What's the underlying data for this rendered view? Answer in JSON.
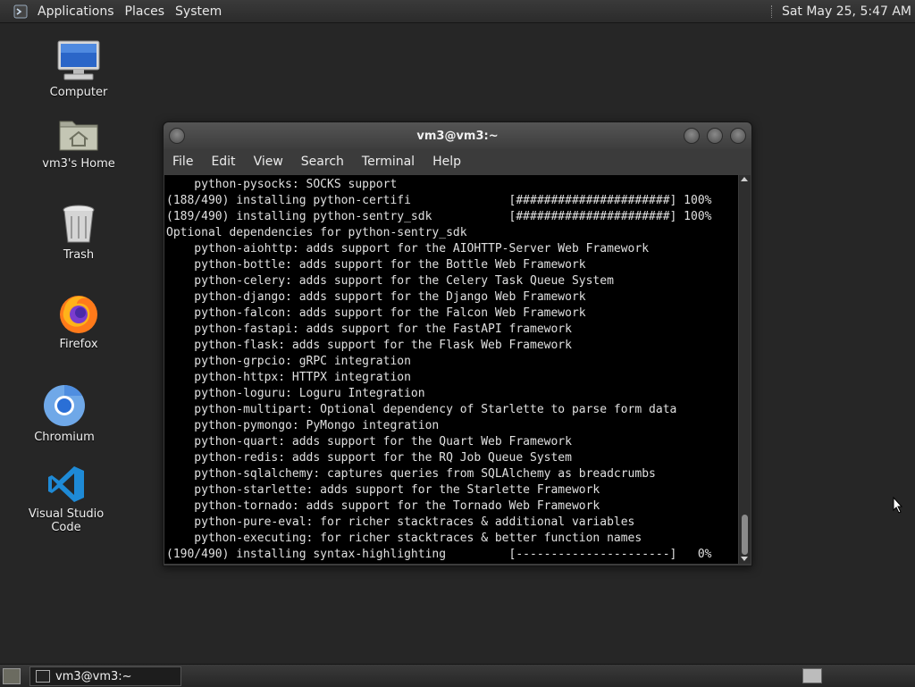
{
  "top_panel": {
    "applications": "Applications",
    "places": "Places",
    "system": "System",
    "clock": "Sat May 25,  5:47 AM"
  },
  "desktop": {
    "icons": [
      {
        "label": "Computer",
        "icon": "computer-icon"
      },
      {
        "label": "vm3's Home",
        "icon": "home-folder-icon"
      },
      {
        "label": "Trash",
        "icon": "trash-icon"
      },
      {
        "label": "Firefox",
        "icon": "firefox-icon"
      },
      {
        "label": "Chromium",
        "icon": "chromium-icon"
      },
      {
        "label": "Visual Studio Code",
        "icon": "vscode-icon"
      }
    ]
  },
  "window": {
    "title": "vm3@vm3:~",
    "menu": [
      "File",
      "Edit",
      "View",
      "Search",
      "Terminal",
      "Help"
    ]
  },
  "terminal": {
    "lines": [
      "    python-pysocks: SOCKS support",
      "(188/490) installing python-certifi              [######################] 100%",
      "(189/490) installing python-sentry_sdk           [######################] 100%",
      "Optional dependencies for python-sentry_sdk",
      "    python-aiohttp: adds support for the AIOHTTP-Server Web Framework",
      "    python-bottle: adds support for the Bottle Web Framework",
      "    python-celery: adds support for the Celery Task Queue System",
      "    python-django: adds support for the Django Web Framework",
      "    python-falcon: adds support for the Falcon Web Framework",
      "    python-fastapi: adds support for the FastAPI framework",
      "    python-flask: adds support for the Flask Web Framework",
      "    python-grpcio: gRPC integration",
      "    python-httpx: HTTPX integration",
      "    python-loguru: Loguru Integration",
      "    python-multipart: Optional dependency of Starlette to parse form data",
      "    python-pymongo: PyMongo integration",
      "    python-quart: adds support for the Quart Web Framework",
      "    python-redis: adds support for the RQ Job Queue System",
      "    python-sqlalchemy: captures queries from SQLAlchemy as breadcrumbs",
      "    python-starlette: adds support for the Starlette Framework",
      "    python-tornado: adds support for the Tornado Web Framework",
      "    python-pure-eval: for richer stacktraces & additional variables",
      "    python-executing: for richer stacktraces & better function names",
      "(190/490) installing syntax-highlighting         [----------------------]   0%"
    ]
  },
  "taskbar": {
    "task_label": "vm3@vm3:~"
  },
  "colors": {
    "desktop_bg": "#262626",
    "terminal_bg": "#000000",
    "terminal_fg": "#e0e0e0"
  }
}
